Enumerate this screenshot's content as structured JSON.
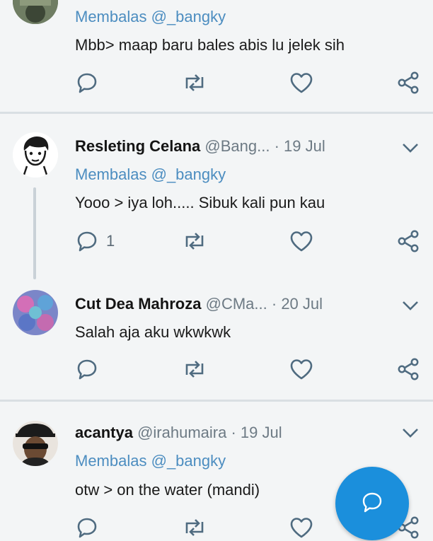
{
  "tweets": [
    {
      "reply_prefix": "Membalas",
      "reply_to": "@_bangky",
      "text": "Mbb> maap baru bales abis lu jelek sih",
      "reply_count": ""
    },
    {
      "name": "Resleting Celana",
      "handle": "@Bang...",
      "dot": "·",
      "time": "19 Jul",
      "reply_prefix": "Membalas",
      "reply_to": "@_bangky",
      "text": "Yooo > iya loh..... Sibuk kali pun kau",
      "reply_count": "1"
    },
    {
      "name": "Cut Dea Mahroza",
      "handle": "@CMa...",
      "dot": "·",
      "time": "20 Jul",
      "text": "Salah aja aku wkwkwk",
      "reply_count": ""
    },
    {
      "name": "acantya",
      "handle": "@irahumaira",
      "dot": "·",
      "time": "19 Jul",
      "reply_prefix": "Membalas",
      "reply_to": "@_bangky",
      "text": "otw > on the water (mandi)",
      "reply_count": ""
    }
  ],
  "icons": {
    "reply": "reply-icon",
    "retweet": "retweet-icon",
    "like": "heart-icon",
    "share": "share-icon",
    "more": "chevron-down-icon",
    "compose": "compose-reply-icon"
  },
  "colors": {
    "accent": "#1b8fdc",
    "mention": "#4c8dc0",
    "icon": "#4f6b80",
    "divider": "#d9dfe3"
  }
}
